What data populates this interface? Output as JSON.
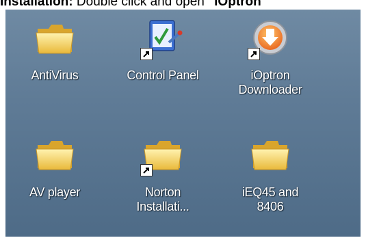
{
  "header_text": {
    "bold_part": "Installation:",
    "normal_part": " Double click and open ",
    "trailing_bold": "\"iOptron"
  },
  "desktop": {
    "icons": [
      {
        "label": "AntiVirus",
        "label2": "",
        "icon": "folder-icon",
        "shortcut": false
      },
      {
        "label": "Control Panel",
        "label2": "",
        "icon": "control-panel-icon",
        "shortcut": true
      },
      {
        "label": "iOptron",
        "label2": "Downloader",
        "icon": "downloader-icon",
        "shortcut": true
      },
      {
        "label": "AV player",
        "label2": "",
        "icon": "folder-icon",
        "shortcut": false
      },
      {
        "label": "Norton",
        "label2": "Installati...",
        "icon": "folder-icon",
        "shortcut": true
      },
      {
        "label": "iEQ45 and",
        "label2": "8406",
        "icon": "folder-icon",
        "shortcut": false
      }
    ]
  },
  "colors": {
    "desktop_bg": "#5f7b96",
    "folder_yellow": "#f4d35e",
    "label_text": "#ffffff"
  }
}
